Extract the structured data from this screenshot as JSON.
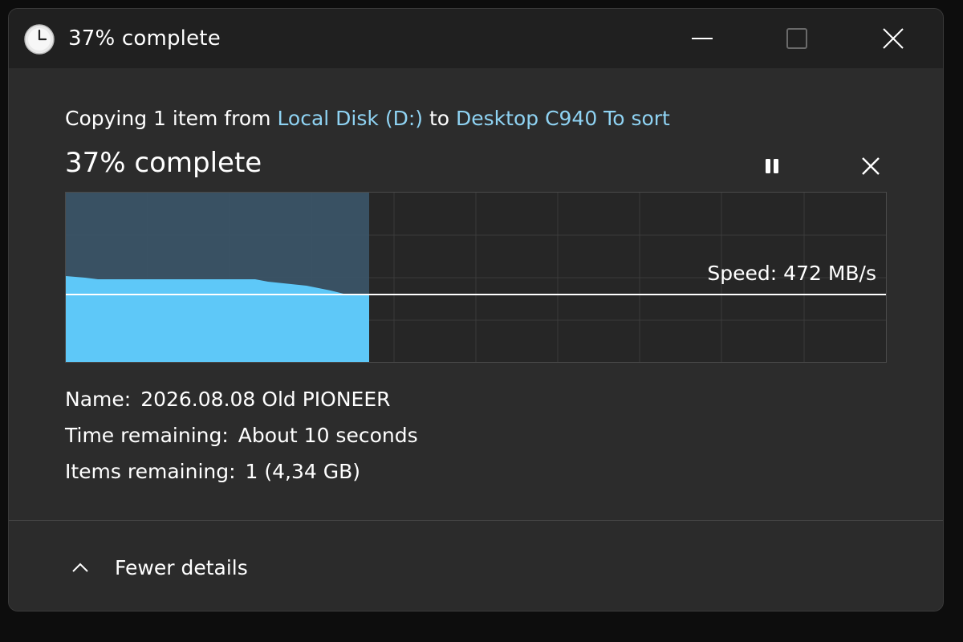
{
  "window": {
    "title": "37% complete"
  },
  "copy": {
    "prefix": "Copying 1 item from ",
    "source": "Local Disk (D:)",
    "middle": " to ",
    "destination": "Desktop C940 To sort"
  },
  "progress": {
    "heading": "37% complete",
    "percent": 37
  },
  "graph": {
    "speed_label": "Speed: 472 MB/s",
    "speed_mbps": 472
  },
  "details": {
    "name_label": "Name:",
    "name_value": "2026.08.08 Old PIONEER",
    "time_label": "Time remaining:",
    "time_value": "About 10 seconds",
    "items_label": "Items remaining:",
    "items_value": "1 (4,34 GB)"
  },
  "footer": {
    "toggle_label": "Fewer details"
  },
  "icons": {
    "app": "clock-icon",
    "minimize": "minimize-icon",
    "maximize": "maximize-icon",
    "close": "close-icon",
    "pause": "pause-icon",
    "cancel": "cancel-icon",
    "toggle": "chevron-up-icon"
  },
  "colors": {
    "link": "#8fd3f3",
    "graph_fill": "#5ec8f8",
    "graph_history": "#3a5366"
  }
}
